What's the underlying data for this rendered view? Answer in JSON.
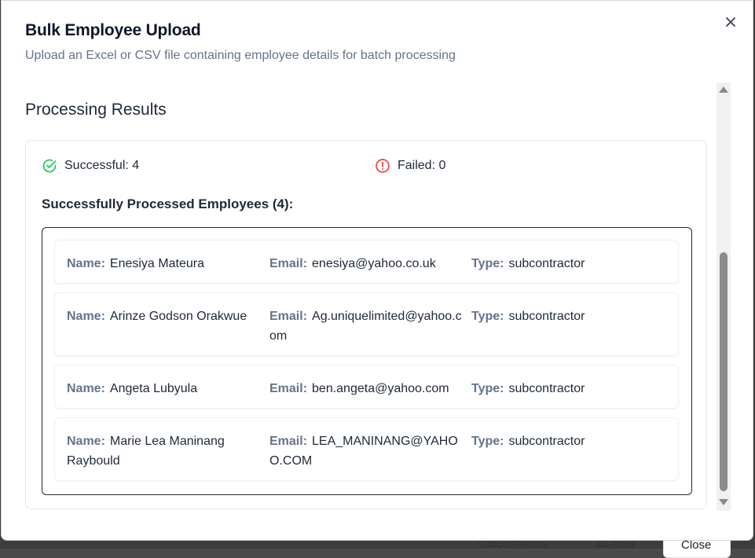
{
  "dialog": {
    "title": "Bulk Employee Upload",
    "description": "Upload an Excel or CSV file containing employee details for batch processing"
  },
  "results": {
    "section_title": "Processing Results",
    "successful_label": "Successful: 4",
    "failed_label": "Failed: 0",
    "list_heading": "Successfully Processed Employees (4):",
    "labels": {
      "name": "Name:",
      "email": "Email:",
      "type": "Type:"
    },
    "employees": [
      {
        "name": "Enesiya Mateura",
        "email": "enesiya@yahoo.co.uk",
        "type": "subcontractor"
      },
      {
        "name": "Arinze Godson Orakwue",
        "email": "Ag.uniquelimited@yahoo.com",
        "type": "subcontractor"
      },
      {
        "name": "Angeta Lubyula",
        "email": "ben.angeta@yahoo.com",
        "type": "subcontractor"
      },
      {
        "name": "Marie Lea Maninang Raybould",
        "email": "LEA_MANINANG@YAHOO.COM",
        "type": "subcontractor"
      }
    ]
  },
  "background_peek": {
    "type_text": "subcontractor",
    "hours_text": "40 hour",
    "button_label": "Close"
  },
  "colors": {
    "success": "#22c55e",
    "error": "#ef4444",
    "muted": "#64748b"
  }
}
